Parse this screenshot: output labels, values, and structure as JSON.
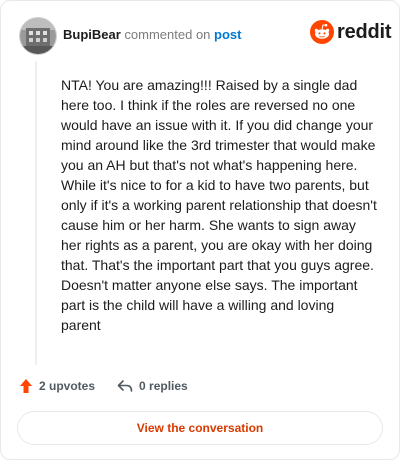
{
  "header": {
    "username": "BupiBear",
    "action_text": "commented on",
    "post_link": "post"
  },
  "brand": {
    "wordmark": "reddit",
    "icon": "reddit-snoo-icon",
    "color": "#ff4500"
  },
  "comment": {
    "body": "NTA! You are amazing!!! Raised by a single dad here too. I think if the roles are reversed no one would have an issue with it. If you did change your mind around like the 3rd trimester that would make you an AH but that's not what's happening here. While it's nice to for a kid to have two parents, but only if it's a working parent relationship that doesn't cause him or her harm. She wants to sign away her rights as a parent, you are okay with her doing that. That's the important part that you guys agree. Doesn't matter anyone else says. The important part is the child will have a willing and loving parent"
  },
  "footer": {
    "upvotes": "2 upvotes",
    "upvote_icon": "upvote-arrow-icon",
    "upvote_color": "#ff4500",
    "replies": "0 replies",
    "reply_icon": "reply-arrow-icon",
    "view_button": "View the conversation",
    "view_button_color": "#d93a00"
  }
}
